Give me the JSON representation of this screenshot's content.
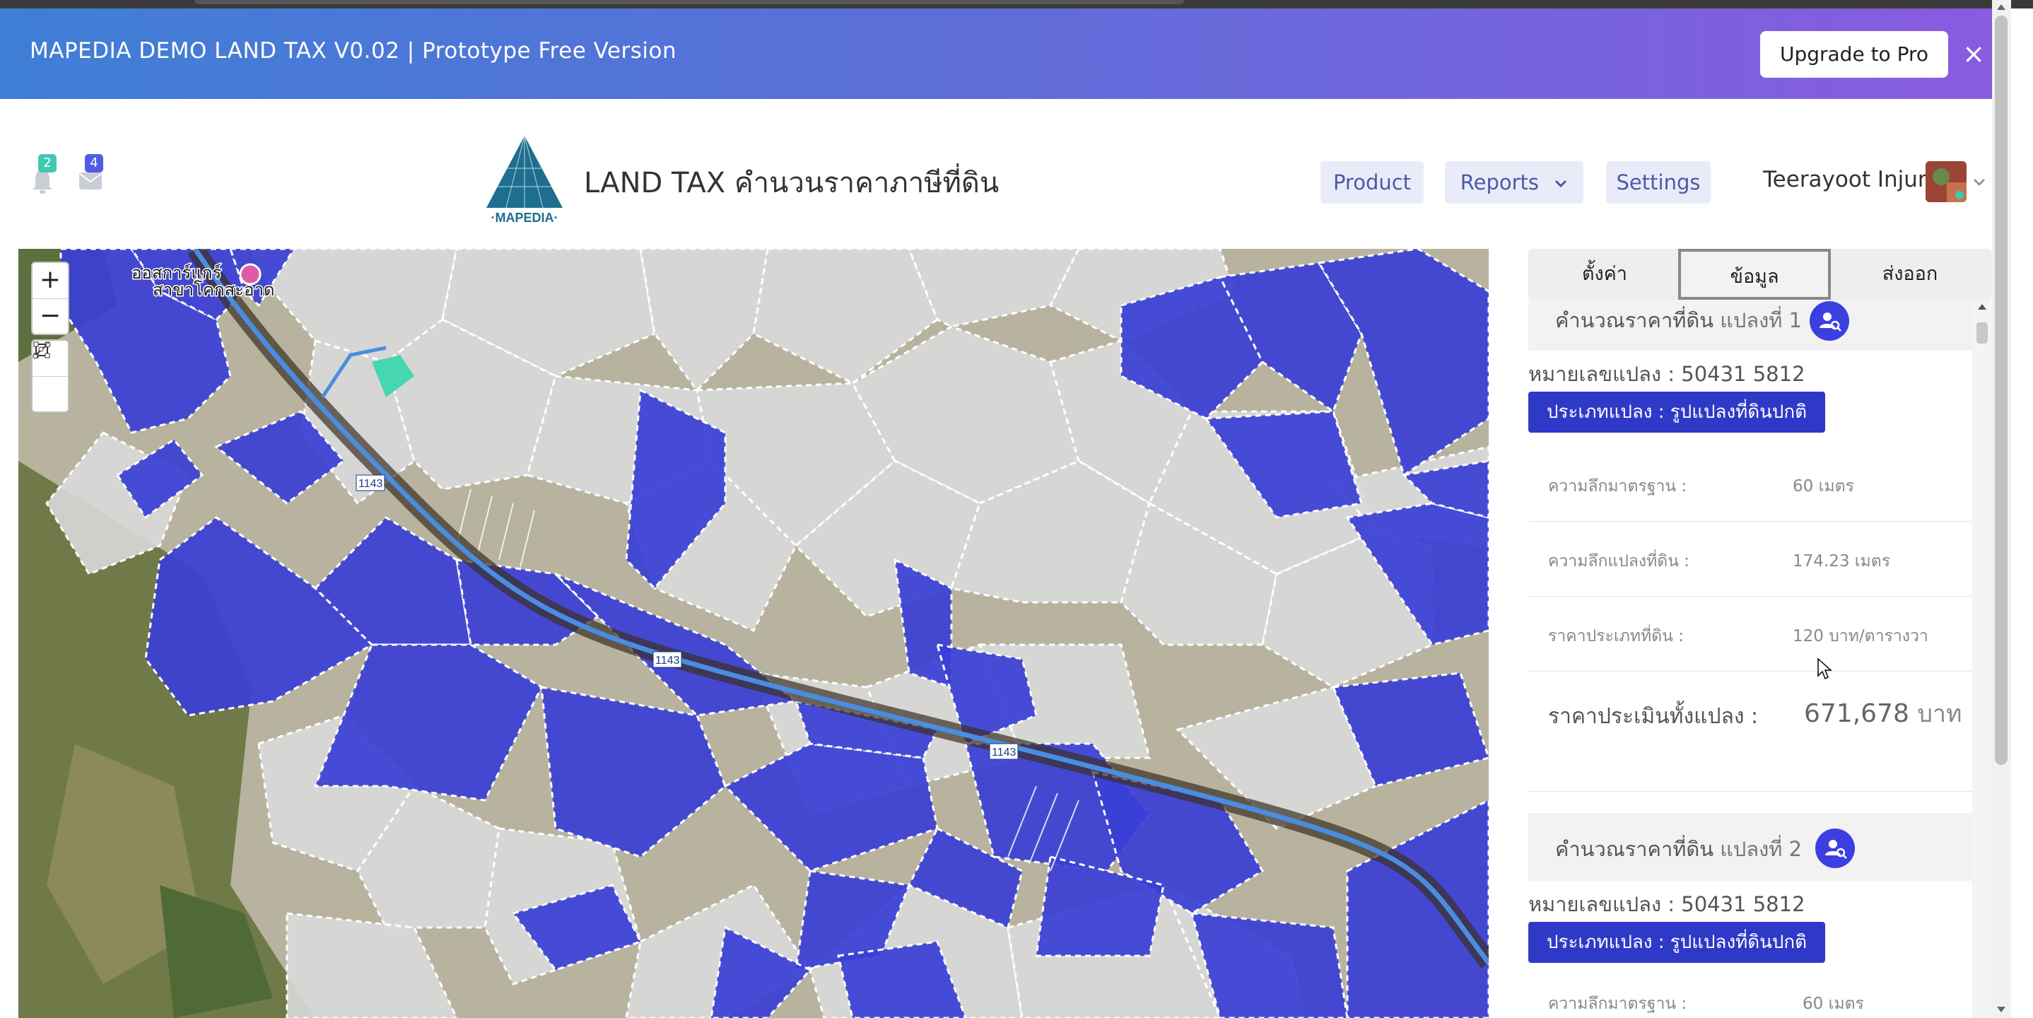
{
  "promo": {
    "title": "MAPEDIA DEMO LAND TAX V0.02 | Prototype Free Version",
    "upgrade_label": "Upgrade to Pro",
    "close_symbol": "×"
  },
  "notifications": {
    "bell_count": "2",
    "mail_count": "4",
    "bell_color": "#3fc9b0",
    "mail_color": "#4f5ee0"
  },
  "brand": {
    "logo_text": "·MAPEDIA·",
    "title": "LAND TAX คำนวนราคาภาษีที่ดิน"
  },
  "nav": {
    "product": "Product",
    "reports": "Reports",
    "settings": "Settings",
    "user_name": "Teerayoot Injun"
  },
  "map": {
    "zoom_in": "+",
    "zoom_out": "−",
    "road_labels": [
      "1143",
      "1143",
      "1143"
    ],
    "place_label": "ออสการ์แกร์",
    "place_label2": "สาขาโคกสะอาด",
    "parcel_color": "#3a3fd6",
    "road_color": "#4a8de0"
  },
  "panel": {
    "tabs": [
      "ตั้งค่า",
      "ข้อมูล",
      "ส่งออก"
    ],
    "active_tab": "ข้อมูล",
    "sections": [
      {
        "title": "คำนวณราคาที่ดิน",
        "parcel_no": "แปลงที่ 1",
        "parcel_id": "หมายเลขแปลง : 50431 5812",
        "parcel_type": "ประเภทแปลง : รูปแปลงที่ดินปกติ",
        "rows": [
          {
            "label": "ความลึกมาตรฐาน :",
            "value": "60 เมตร"
          },
          {
            "label": "ความลึกแปลงที่ดิน :",
            "value": "174.23 เมตร"
          },
          {
            "label": "ราคาประเภทที่ดิน :",
            "value": "120 บาท/ตารางวา"
          }
        ],
        "total_label": "ราคาประเมินทั้งแปลง :",
        "total_value": "671,678",
        "total_unit": "บาท"
      },
      {
        "title": "คำนวณราคาที่ดิน",
        "parcel_no": "แปลงที่ 2",
        "parcel_id": "หมายเลขแปลง : 50431 5812",
        "parcel_type": "ประเภทแปลง : รูปแปลงที่ดินปกติ",
        "rows": [
          {
            "label": "ความลึกมาตรฐาน :",
            "value": "60 เมตร"
          }
        ]
      }
    ]
  }
}
